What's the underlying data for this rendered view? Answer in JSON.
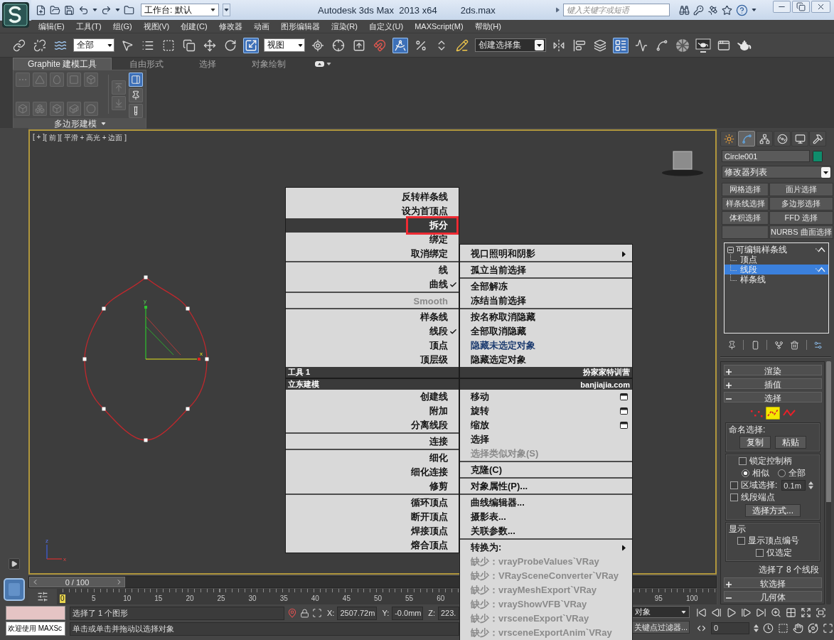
{
  "title_bar": {
    "workspace": "工作台: 默认",
    "app_title": "Autodesk 3ds Max  2013 x64",
    "file_name": "2ds.max",
    "search": {
      "placeholder": "键入关键字或短语"
    }
  },
  "menu_bar": [
    "编辑(E)",
    "工具(T)",
    "组(G)",
    "视图(V)",
    "创建(C)",
    "修改器",
    "动画",
    "图形编辑器",
    "渲染(R)",
    "自定义(U)",
    "MAXScript(M)",
    "帮助(H)"
  ],
  "main_toolbar": [
    {
      "kind": "tool",
      "on": false
    },
    {
      "kind": "tool",
      "on": false
    },
    {
      "kind": "tool",
      "on": false
    },
    {
      "kind": "dropdown",
      "value": "全部"
    },
    {
      "kind": "tool",
      "on": false
    },
    {
      "kind": "tool",
      "on": false
    },
    {
      "kind": "tool",
      "on": false
    },
    {
      "kind": "tool",
      "on": false
    },
    {
      "kind": "tool",
      "on": false
    },
    {
      "kind": "tool",
      "on": false
    },
    {
      "kind": "tool",
      "on": true
    },
    {
      "kind": "dropdown",
      "value": "视图"
    },
    {
      "kind": "tool",
      "on": false
    },
    {
      "kind": "tool",
      "on": false
    },
    {
      "kind": "tool",
      "on": false
    },
    {
      "kind": "tool",
      "on": false
    },
    {
      "kind": "tool",
      "on": true
    },
    {
      "kind": "tool",
      "on": false
    },
    {
      "kind": "tool",
      "on": false
    },
    {
      "kind": "tool",
      "on": false
    },
    {
      "kind": "combo",
      "value": "创建选择集"
    },
    {
      "kind": "tool",
      "on": false
    },
    {
      "kind": "tool",
      "on": false
    },
    {
      "kind": "tool",
      "on": false
    },
    {
      "kind": "tool",
      "on": true
    },
    {
      "kind": "tool",
      "on": false
    },
    {
      "kind": "tool",
      "on": false
    },
    {
      "kind": "tool",
      "on": false
    },
    {
      "kind": "tool",
      "on": false
    },
    {
      "kind": "tool",
      "on": false
    },
    {
      "kind": "tool",
      "on": false
    }
  ],
  "ribbon": {
    "tabs": [
      {
        "label": "Graphite 建模工具",
        "selected": true
      },
      {
        "label": "自由形式",
        "selected": false
      },
      {
        "label": "选择",
        "selected": false
      },
      {
        "label": "对象绘制",
        "selected": false
      }
    ],
    "tools": [
      {
        "disabled": true,
        "on": false
      },
      {
        "disabled": true,
        "on": false
      },
      {
        "disabled": true,
        "on": false
      },
      {
        "disabled": true,
        "on": false
      },
      {
        "disabled": true,
        "on": false
      },
      {
        "disabled": true,
        "on": false
      },
      {
        "disabled": true,
        "on": false
      },
      {
        "disabled": true,
        "on": false
      },
      {
        "disabled": true,
        "on": false
      },
      {
        "disabled": true,
        "on": false
      },
      {
        "disabled": true,
        "on": false
      },
      {
        "disabled": true,
        "on": false
      },
      {
        "disabled": false,
        "on": true
      },
      {
        "disabled": false,
        "on": false
      },
      {
        "disabled": false,
        "on": false
      }
    ],
    "panel_title": "多边形建模"
  },
  "viewport": {
    "active": true,
    "labels": [
      "[ + ]",
      "[ 前 ]",
      "[ 平滑 + 高光 + 边面 ]"
    ],
    "gizmo_labels": {
      "x": "x",
      "y": "y"
    },
    "axis_labels": {
      "z": "z",
      "x": "x"
    }
  },
  "quad_menu": {
    "top_left": {
      "title": "工具 1",
      "groups": [
        [
          {
            "label": "反转样条线",
            "kind": "command",
            "selected": false,
            "disabled": false,
            "recent": false,
            "annotated": false
          },
          {
            "label": "设为首顶点",
            "kind": "command",
            "selected": false,
            "disabled": false,
            "recent": false,
            "annotated": false
          },
          {
            "label": "拆分",
            "kind": "command",
            "selected": true,
            "disabled": false,
            "recent": false,
            "annotated": true
          },
          {
            "label": "绑定",
            "kind": "command",
            "selected": false,
            "disabled": false,
            "recent": false,
            "annotated": false
          },
          {
            "label": "取消绑定",
            "kind": "command",
            "selected": false,
            "disabled": false,
            "recent": false,
            "annotated": false
          }
        ],
        [
          {
            "label": "线",
            "kind": "command",
            "checked": false,
            "selected": false,
            "disabled": false,
            "recent": false,
            "annotated": false
          },
          {
            "label": "曲线",
            "kind": "command",
            "checked": true,
            "selected": false,
            "disabled": false,
            "recent": false,
            "annotated": false
          }
        ],
        [
          {
            "label": "Smooth",
            "kind": "command",
            "selected": false,
            "disabled": true,
            "recent": false,
            "annotated": false
          }
        ],
        [
          {
            "label": "样条线",
            "kind": "command",
            "checked": false,
            "selected": false,
            "disabled": false,
            "recent": false,
            "annotated": false
          },
          {
            "label": "线段",
            "kind": "command",
            "checked": true,
            "selected": false,
            "disabled": false,
            "recent": false,
            "annotated": false
          },
          {
            "label": "顶点",
            "kind": "command",
            "checked": false,
            "selected": false,
            "disabled": false,
            "recent": false,
            "annotated": false
          },
          {
            "label": "顶层级",
            "kind": "command",
            "checked": false,
            "selected": false,
            "disabled": false,
            "recent": false,
            "annotated": false
          }
        ]
      ]
    },
    "top_right": {
      "title": "扮家家特训营",
      "groups": [
        [
          {
            "label": "视口照明和阴影",
            "kind": "submenu",
            "selected": false,
            "disabled": false,
            "recent": false,
            "annotated": false
          }
        ],
        [
          {
            "label": "孤立当前选择",
            "kind": "command",
            "selected": false,
            "disabled": false,
            "recent": false,
            "annotated": false
          }
        ],
        [
          {
            "label": "全部解冻",
            "kind": "command",
            "selected": false,
            "disabled": false,
            "recent": false,
            "annotated": false
          },
          {
            "label": "冻结当前选择",
            "kind": "command",
            "selected": false,
            "disabled": false,
            "recent": false,
            "annotated": false
          }
        ],
        [
          {
            "label": "按名称取消隐藏",
            "kind": "command",
            "selected": false,
            "disabled": false,
            "recent": false,
            "annotated": false
          },
          {
            "label": "全部取消隐藏",
            "kind": "command",
            "selected": false,
            "disabled": false,
            "recent": false,
            "annotated": false
          },
          {
            "label": "隐藏未选定对象",
            "kind": "command",
            "selected": false,
            "disabled": false,
            "recent": true,
            "annotated": false
          },
          {
            "label": "隐藏选定对象",
            "kind": "command",
            "selected": false,
            "disabled": false,
            "recent": false,
            "annotated": false
          }
        ]
      ]
    },
    "bottom_left": {
      "title": "立东建模",
      "groups": [
        [
          {
            "label": "创建线",
            "kind": "command",
            "selected": false,
            "disabled": false,
            "recent": false,
            "annotated": false
          },
          {
            "label": "附加",
            "kind": "command",
            "selected": false,
            "disabled": false,
            "recent": false,
            "annotated": false
          },
          {
            "label": "分离线段",
            "kind": "command",
            "selected": false,
            "disabled": false,
            "recent": false,
            "annotated": false
          }
        ],
        [
          {
            "label": "连接",
            "kind": "command",
            "selected": false,
            "disabled": false,
            "recent": false,
            "annotated": false
          }
        ],
        [
          {
            "label": "细化",
            "kind": "command",
            "selected": false,
            "disabled": false,
            "recent": false,
            "annotated": false
          },
          {
            "label": "细化连接",
            "kind": "command",
            "selected": false,
            "disabled": false,
            "recent": false,
            "annotated": false
          },
          {
            "label": "修剪",
            "kind": "command",
            "selected": false,
            "disabled": false,
            "recent": false,
            "annotated": false
          }
        ],
        [
          {
            "label": "循环顶点",
            "kind": "command",
            "selected": false,
            "disabled": false,
            "recent": false,
            "annotated": false
          },
          {
            "label": "断开顶点",
            "kind": "command",
            "selected": false,
            "disabled": false,
            "recent": false,
            "annotated": false
          },
          {
            "label": "焊接顶点",
            "kind": "command",
            "selected": false,
            "disabled": false,
            "recent": false,
            "annotated": false
          },
          {
            "label": "熔合顶点",
            "kind": "command",
            "selected": false,
            "disabled": false,
            "recent": false,
            "annotated": false
          }
        ]
      ]
    },
    "bottom_right": {
      "title": "banjiajia.com",
      "groups": [
        [
          {
            "label": "移动",
            "kind": "options",
            "selected": false,
            "disabled": false,
            "recent": false,
            "annotated": false
          },
          {
            "label": "旋转",
            "kind": "options",
            "selected": false,
            "disabled": false,
            "recent": false,
            "annotated": false
          },
          {
            "label": "缩放",
            "kind": "options",
            "selected": false,
            "disabled": false,
            "recent": false,
            "annotated": false
          },
          {
            "label": "选择",
            "kind": "command",
            "selected": false,
            "disabled": false,
            "recent": false,
            "annotated": false
          },
          {
            "label": "选择类似对象(S)",
            "kind": "command",
            "selected": false,
            "disabled": true,
            "recent": false,
            "annotated": false
          }
        ],
        [
          {
            "label": "克隆(C)",
            "kind": "command",
            "selected": false,
            "disabled": false,
            "recent": false,
            "annotated": false
          }
        ],
        [
          {
            "label": "对象属性(P)...",
            "kind": "command",
            "selected": false,
            "disabled": false,
            "recent": false,
            "annotated": false
          }
        ],
        [
          {
            "label": "曲线编辑器...",
            "kind": "command",
            "selected": false,
            "disabled": false,
            "recent": false,
            "annotated": false
          },
          {
            "label": "摄影表...",
            "kind": "command",
            "selected": false,
            "disabled": false,
            "recent": false,
            "annotated": false
          },
          {
            "label": "关联参数...",
            "kind": "command",
            "selected": false,
            "disabled": false,
            "recent": false,
            "annotated": false
          }
        ],
        [
          {
            "label": "转换为:",
            "kind": "submenu",
            "selected": false,
            "disabled": false,
            "recent": false,
            "annotated": false
          },
          {
            "label": "缺少：vrayProbeValues`VRay",
            "kind": "command",
            "selected": false,
            "disabled": true,
            "recent": false,
            "annotated": false
          },
          {
            "label": "缺少：VRaySceneConverter`VRay",
            "kind": "command",
            "selected": false,
            "disabled": true,
            "recent": false,
            "annotated": false
          },
          {
            "label": "缺少：vrayMeshExport`VRay",
            "kind": "command",
            "selected": false,
            "disabled": true,
            "recent": false,
            "annotated": false
          },
          {
            "label": "缺少：vrayShowVFB`VRay",
            "kind": "command",
            "selected": false,
            "disabled": true,
            "recent": false,
            "annotated": false
          },
          {
            "label": "缺少：vrsceneExport`VRay",
            "kind": "command",
            "selected": false,
            "disabled": true,
            "recent": false,
            "annotated": false
          },
          {
            "label": "缺少：vrsceneExportAnim`VRay",
            "kind": "command",
            "selected": false,
            "disabled": true,
            "recent": false,
            "annotated": false
          }
        ]
      ]
    }
  },
  "command_panel": {
    "tabs": [
      {
        "selected": false
      },
      {
        "selected": true
      },
      {
        "selected": false
      },
      {
        "selected": false
      },
      {
        "selected": false
      },
      {
        "selected": false
      }
    ],
    "object_name": "Circle001",
    "modifier_list": "修改器列表",
    "modifier_buttons": [
      {
        "kind": "button",
        "label": "网格选择"
      },
      {
        "kind": "button",
        "label": "面片选择"
      },
      {
        "kind": "button",
        "label": "样条线选择"
      },
      {
        "kind": "button",
        "label": "多边形选择"
      },
      {
        "kind": "button",
        "label": "体积选择"
      },
      {
        "kind": "button",
        "label": "FFD 选择"
      },
      {
        "kind": "blank"
      },
      {
        "kind": "button",
        "label": "NURBS 曲面选择"
      }
    ],
    "stack": [
      {
        "label": "可编辑样条线",
        "expanded": true,
        "selected": false,
        "children": [
          {
            "label": "顶点",
            "selected": false
          },
          {
            "label": "线段",
            "selected": true
          },
          {
            "label": "样条线",
            "selected": false
          }
        ]
      }
    ],
    "rollouts": [
      {
        "label": "渲染",
        "expanded": false
      },
      {
        "label": "插值",
        "expanded": false
      },
      {
        "label": "选择",
        "expanded": true,
        "selection": {
          "levels": [
            {
              "selected": false
            },
            {
              "selected": true
            },
            {
              "selected": false
            }
          ],
          "named_selection": {
            "title": "命名选择:",
            "buttons": [
              "复制",
              "粘贴"
            ]
          },
          "lock_handles": {
            "label": "锁定控制柄",
            "checked": false
          },
          "handle_mode": [
            {
              "label": "相似",
              "selected": true
            },
            {
              "label": "全部",
              "selected": false
            }
          ],
          "area_selection": {
            "label": "区域选择:",
            "checked": false,
            "value": "0.1m"
          },
          "segment_end": {
            "label": "线段端点",
            "checked": false
          },
          "select_by": "选择方式...",
          "display": {
            "title": "显示",
            "options": [
              {
                "label": "显示顶点编号",
                "checked": false,
                "children": [
                  {
                    "label": "仅选定",
                    "checked": false
                  }
                ]
              }
            ]
          },
          "status": "选择了 8 个线段"
        }
      },
      {
        "label": "软选择",
        "expanded": false
      },
      {
        "label": "几何体",
        "expanded": true
      }
    ]
  },
  "time_slider": {
    "label": "0 / 100"
  },
  "track_bar": {
    "ticks_start": [
      {
        "label": "0",
        "current": true
      },
      {
        "label": "5",
        "current": false
      },
      {
        "label": "10",
        "current": false
      },
      {
        "label": "15",
        "current": false
      },
      {
        "label": "20",
        "current": false
      },
      {
        "label": "25",
        "current": false
      },
      {
        "label": "30",
        "current": false
      },
      {
        "label": "35",
        "current": false
      },
      {
        "label": "40",
        "current": false
      },
      {
        "label": "45",
        "current": false
      },
      {
        "label": "50",
        "current": false
      },
      {
        "label": "55",
        "current": false
      },
      {
        "label": "60",
        "current": false
      }
    ],
    "ticks_end": [
      {
        "label": "95",
        "current": false
      },
      {
        "label": "100",
        "current": false
      }
    ]
  },
  "status_bar": {
    "listener_output": "欢迎使用 MAXSc",
    "selection": "选择了 1 个图形",
    "prompt": "单击或单击并拖动以选择对象",
    "coords": [
      {
        "label": "X:",
        "value": "2507.72m"
      },
      {
        "label": "Y:",
        "value": "-0.0mm"
      },
      {
        "label": "Z:",
        "value": "223."
      }
    ],
    "key_target": "对象",
    "key_filters": "关键点过滤器...",
    "frame": "0"
  }
}
